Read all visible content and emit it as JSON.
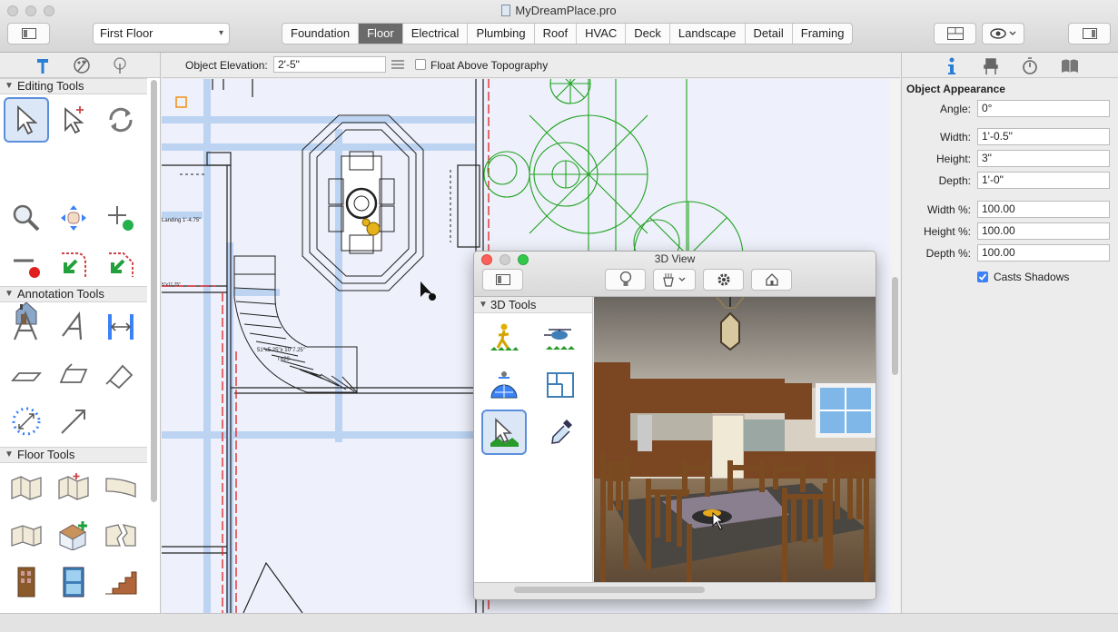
{
  "window": {
    "title": "MyDreamPlace.pro",
    "floor_select": "First Floor",
    "tabs": [
      "Foundation",
      "Floor",
      "Electrical",
      "Plumbing",
      "Roof",
      "HVAC",
      "Deck",
      "Landscape",
      "Detail",
      "Framing"
    ],
    "active_tab": "Floor"
  },
  "options_bar": {
    "elevation_label": "Object Elevation:",
    "elevation_value": "2'-5\"",
    "float_label": "Float Above Topography"
  },
  "left_panel": {
    "sections": [
      {
        "title": "Editing Tools"
      },
      {
        "title": "Annotation Tools"
      },
      {
        "title": "Floor Tools"
      }
    ]
  },
  "plan": {
    "labels": [
      "Landing 1'-4.75\"",
      "51\"x5.25\"x 10\"7.25\"",
      "T=29",
      "5\"x11.75\""
    ]
  },
  "view3d": {
    "title": "3D View",
    "tools_header": "3D Tools"
  },
  "right_panel": {
    "section_title": "Object Appearance",
    "fields": [
      {
        "label": "Angle:",
        "value": "0°"
      },
      {
        "label": "Width:",
        "value": "1'-0.5\""
      },
      {
        "label": "Height:",
        "value": "3\""
      },
      {
        "label": "Depth:",
        "value": "1'-0\""
      },
      {
        "label": "Width %:",
        "value": "100.00"
      },
      {
        "label": "Height %:",
        "value": "100.00"
      },
      {
        "label": "Depth %:",
        "value": "100.00"
      }
    ],
    "casts_shadows_label": "Casts Shadows",
    "casts_shadows_checked": true
  },
  "colors": {
    "accent": "#3b82f6",
    "plan_bg": "#eef0fb",
    "landscape_green": "#1fa31f"
  }
}
